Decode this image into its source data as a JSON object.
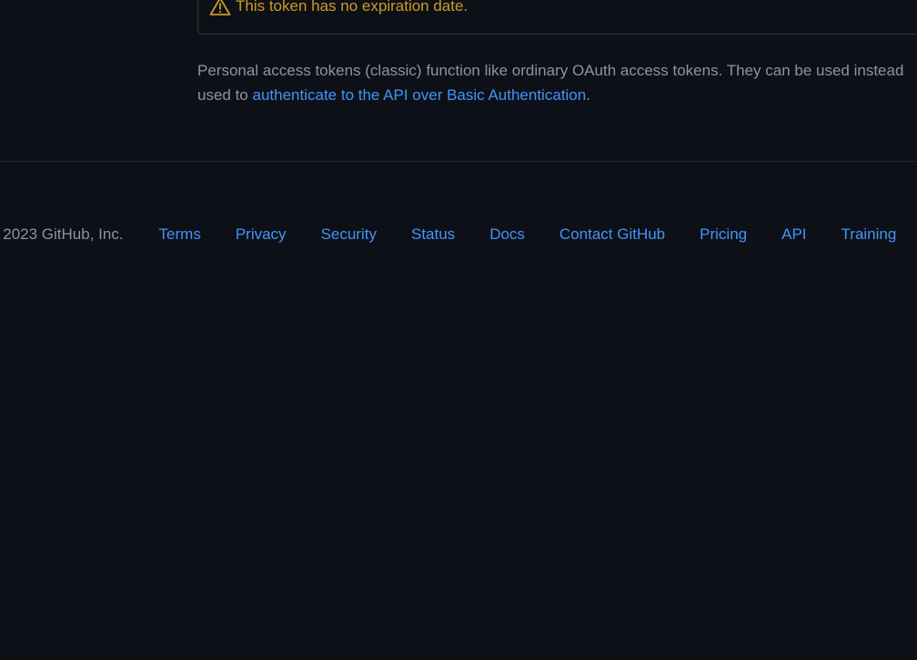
{
  "warning": {
    "icon": "alert-triangle-icon",
    "text": "This token has no expiration date.",
    "color": "#d29922"
  },
  "description": {
    "line1": "Personal access tokens (classic) function like ordinary OAuth access tokens. They can be used instead",
    "line2_prefix": "used to ",
    "link_text": "authenticate to the API over Basic Authentication",
    "line2_suffix": "."
  },
  "footer": {
    "copyright": "© 2023 GitHub, Inc.",
    "links": [
      "Terms",
      "Privacy",
      "Security",
      "Status",
      "Docs",
      "Contact GitHub",
      "Pricing",
      "API",
      "Training"
    ]
  },
  "colors": {
    "background": "#0d1117",
    "muted_text": "#8b949e",
    "link": "#4493f8",
    "border": "#30363d"
  }
}
